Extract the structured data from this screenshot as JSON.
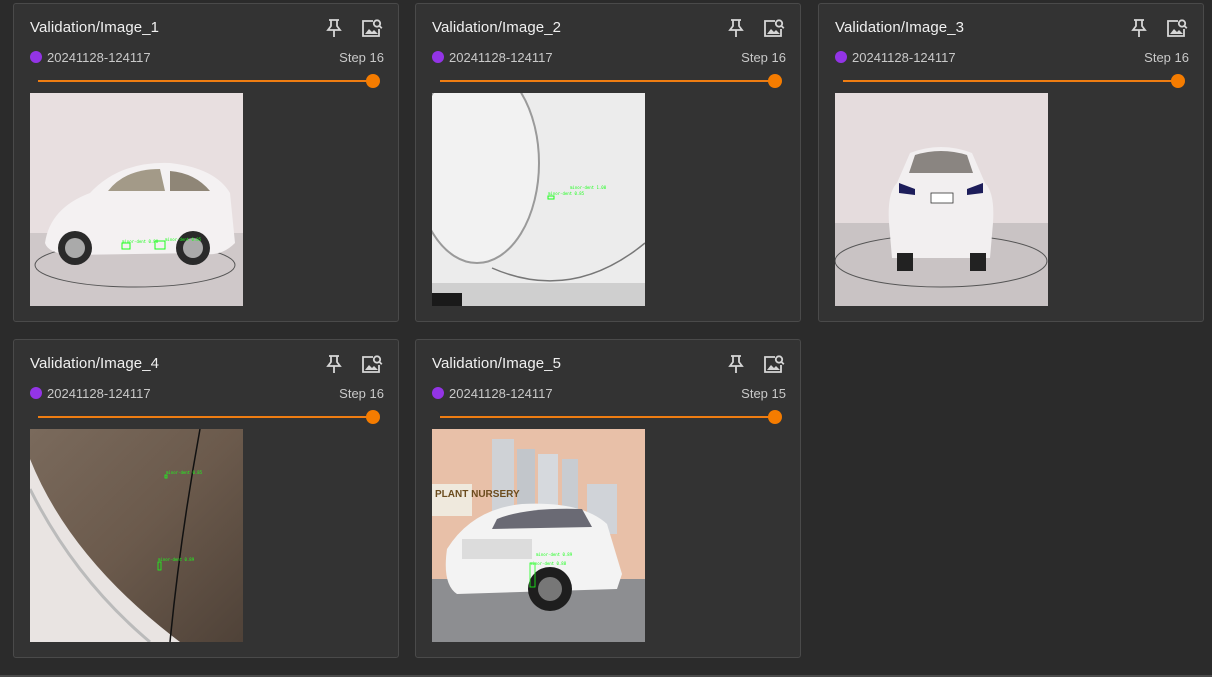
{
  "colors": {
    "background": "#2b2b2b",
    "card": "#333333",
    "run_dot": "#9334e6",
    "slider": "#f57c00",
    "detection_box": "#1aff1a"
  },
  "cards": [
    {
      "title": "Validation/Image_1",
      "run": "20241128-124117",
      "step": "Step 16",
      "step_slider_fraction": 1.0,
      "pin_icon": "pin-icon",
      "inspect_icon": "image-search-icon",
      "image_label_1": "minor-dent 0.88",
      "image_label_2": "minor-dent 0.85"
    },
    {
      "title": "Validation/Image_2",
      "run": "20241128-124117",
      "step": "Step 16",
      "step_slider_fraction": 1.0,
      "pin_icon": "pin-icon",
      "inspect_icon": "image-search-icon",
      "image_label_1": "minor-dent 1.00",
      "image_label_2": "minor-dent 0.85"
    },
    {
      "title": "Validation/Image_3",
      "run": "20241128-124117",
      "step": "Step 16",
      "step_slider_fraction": 1.0,
      "pin_icon": "pin-icon",
      "inspect_icon": "image-search-icon"
    },
    {
      "title": "Validation/Image_4",
      "run": "20241128-124117",
      "step": "Step 16",
      "step_slider_fraction": 1.0,
      "pin_icon": "pin-icon",
      "inspect_icon": "image-search-icon",
      "image_label_1": "minor-dent 0.85",
      "image_label_2": "minor-dent 0.89"
    },
    {
      "title": "Validation/Image_5",
      "run": "20241128-124117",
      "step": "Step 15",
      "step_slider_fraction": 1.0,
      "pin_icon": "pin-icon",
      "inspect_icon": "image-search-icon",
      "image_label_1": "minor-dent 0.89",
      "image_label_2": "minor-dent 0.88",
      "sign_text": "PLANT NURSERY"
    }
  ]
}
